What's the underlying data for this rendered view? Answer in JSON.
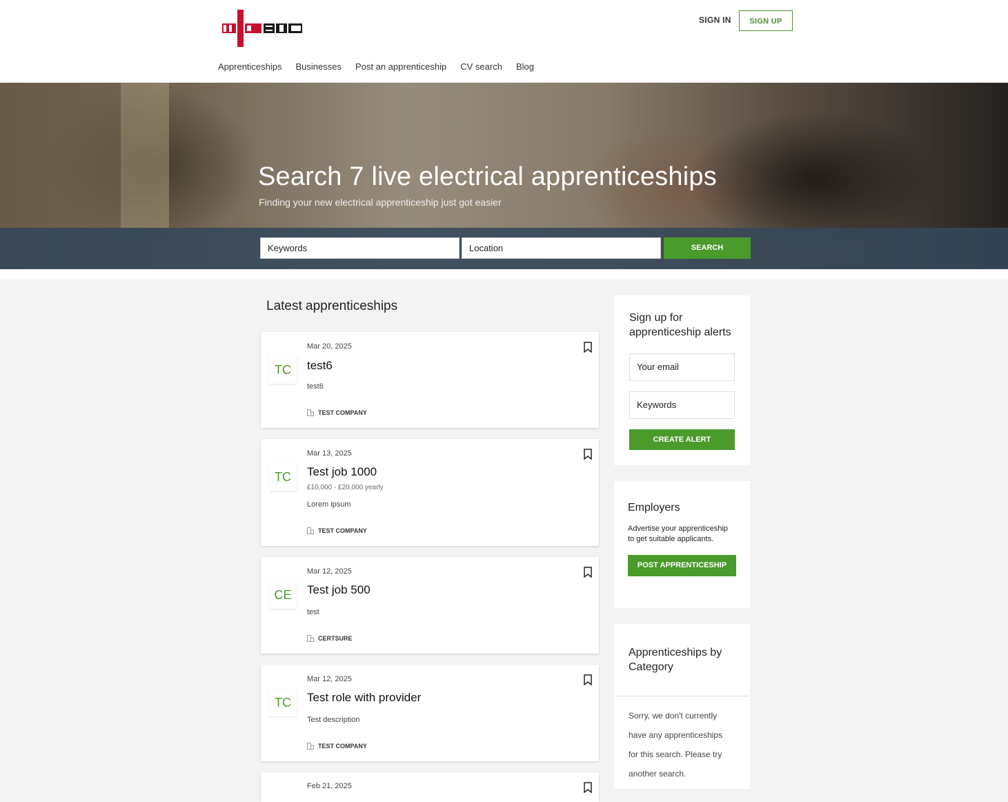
{
  "header": {
    "logo_alt": "NICEIC",
    "sign_in": "SIGN IN",
    "sign_up": "SIGN UP",
    "nav": [
      "Apprenticeships",
      "Businesses",
      "Post an apprenticeship",
      "CV search",
      "Blog"
    ]
  },
  "hero": {
    "title": "Search 7 live electrical apprenticeships",
    "subtitle": "Finding your new electrical apprenticeship just got easier",
    "keywords_value": "Keywords",
    "location_value": "Location",
    "search_label": "SEARCH"
  },
  "main": {
    "section_title": "Latest apprenticeships",
    "jobs": [
      {
        "initials": "TC",
        "date": "Mar 20, 2025",
        "title": "test6",
        "salary": "",
        "description": "test6",
        "company": "TEST COMPANY"
      },
      {
        "initials": "TC",
        "date": "Mar 13, 2025",
        "title": "Test job 1000",
        "salary": "£10,000 - £20,000 yearly",
        "description": "Lorem ipsum",
        "company": "TEST COMPANY"
      },
      {
        "initials": "CE",
        "date": "Mar 12, 2025",
        "title": "Test job 500",
        "salary": "",
        "description": "test",
        "company": "CERTSURE"
      },
      {
        "initials": "TC",
        "date": "Mar 12, 2025",
        "title": "Test role with provider",
        "salary": "",
        "description": "Test description",
        "company": "TEST COMPANY"
      },
      {
        "initials": "",
        "date": "Feb 21, 2025",
        "title": "",
        "salary": "",
        "description": "",
        "company": ""
      }
    ]
  },
  "sidebar": {
    "alerts": {
      "title_line1": "Sign up for",
      "title_line2": "apprenticeship alerts",
      "email_value": "Your email",
      "keywords_value": "Keywords",
      "button": "CREATE ALERT"
    },
    "employers": {
      "title": "Employers",
      "text_line1": "Advertise your apprenticeship",
      "text_line2": "to get suitable applicants.",
      "button": "POST APPRENTICESHIP"
    },
    "category": {
      "title_line1": "Apprenticeships by",
      "title_line2": "Category",
      "empty_line1": "Sorry, we don't currently",
      "empty_line2": "have any apprenticeships",
      "empty_line3": "for this search. Please try",
      "empty_line4": "another search."
    }
  },
  "colors": {
    "brand_green": "#4a9a2c",
    "logo_red": "#c8102e",
    "search_band": "#36485a"
  }
}
